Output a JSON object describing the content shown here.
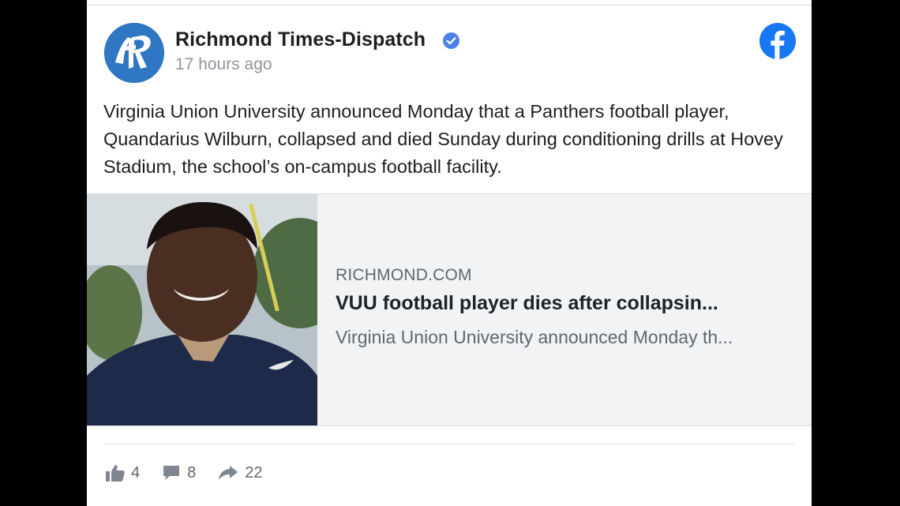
{
  "post": {
    "page_name": "Richmond Times-Dispatch",
    "timestamp": "17 hours ago",
    "verified_icon": "verified-badge-icon",
    "platform_icon": "facebook-logo-icon",
    "avatar_icon": "richmond-times-dispatch-logo",
    "text": "Virginia Union University announced Monday that a Panthers football player, Quandarius Wilburn, collapsed and died Sunday during conditioning drills at Hovey Stadium, the school’s on-campus football facility."
  },
  "link_preview": {
    "image_alt": "photo of football player",
    "domain": "RICHMOND.COM",
    "title": "VUU football player dies after collapsin...",
    "description": "Virginia Union University announced Monday th..."
  },
  "reactions": {
    "likes": "4",
    "comments": "8",
    "shares": "22",
    "like_icon": "thumbs-up-icon",
    "comment_icon": "comment-bubble-icon",
    "share_icon": "share-arrow-icon"
  },
  "colors": {
    "facebook_blue": "#1877f2",
    "avatar_blue": "#2f77c2",
    "text": "#1c1e21",
    "secondary_text": "#606770",
    "link_card_bg": "#f2f3f5"
  }
}
